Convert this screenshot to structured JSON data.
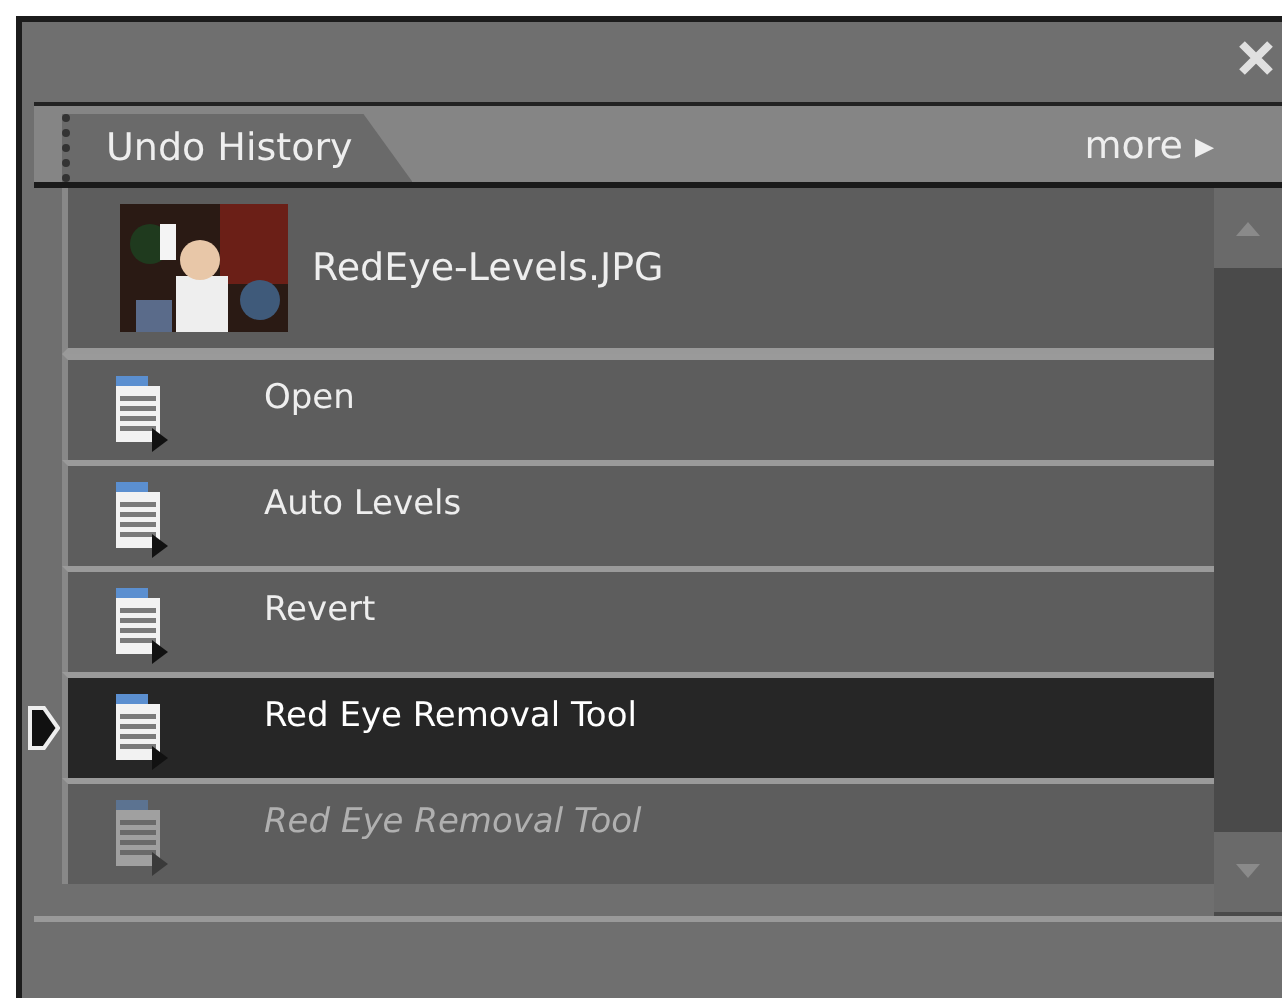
{
  "panel": {
    "tab": "Undo History",
    "more": "more ▸"
  },
  "snapshot": {
    "name": "RedEye-Levels.JPG"
  },
  "steps": [
    {
      "label": "Open",
      "selected": false,
      "undone": false
    },
    {
      "label": "Auto Levels",
      "selected": false,
      "undone": false
    },
    {
      "label": "Revert",
      "selected": false,
      "undone": false
    },
    {
      "label": "Red Eye Removal Tool",
      "selected": true,
      "undone": false
    },
    {
      "label": "Red Eye Removal Tool",
      "selected": false,
      "undone": true
    }
  ]
}
